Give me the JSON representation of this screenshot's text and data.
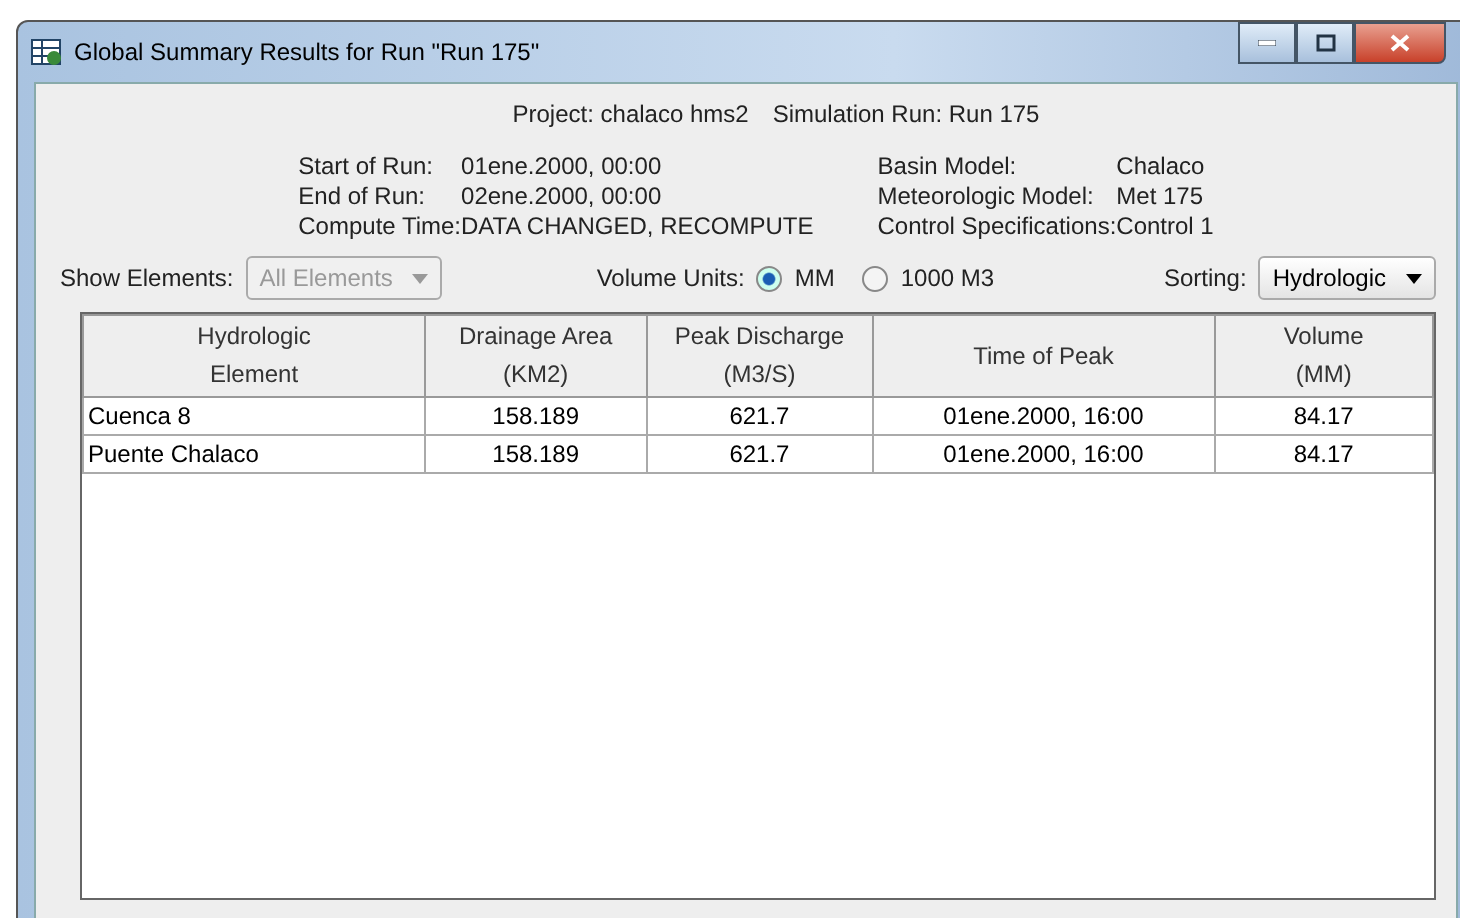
{
  "window": {
    "title": "Global Summary Results for Run \"Run 175\""
  },
  "header": {
    "project": "Project: chalaco hms2",
    "simulation_run": "Simulation Run: Run 175"
  },
  "info_left": [
    {
      "label": "Start of Run:",
      "value": "01ene.2000, 00:00"
    },
    {
      "label": "End of Run:",
      "value": "02ene.2000, 00:00"
    },
    {
      "label": "Compute Time:",
      "value": "DATA CHANGED, RECOMPUTE"
    }
  ],
  "info_right": [
    {
      "label": "Basin Model:",
      "value": "Chalaco"
    },
    {
      "label": "Meteorologic Model:",
      "value": "Met 175"
    },
    {
      "label": "Control Specifications:",
      "value": "Control 1"
    }
  ],
  "show_elements": {
    "label": "Show Elements:",
    "value": "All Elements",
    "disabled": true
  },
  "volume_units": {
    "label": "Volume Units:",
    "options": [
      {
        "label": "MM",
        "selected": true
      },
      {
        "label": "1000 M3",
        "selected": false
      }
    ]
  },
  "sorting": {
    "label": "Sorting:",
    "value": "Hydrologic"
  },
  "table": {
    "columns": [
      "Hydrologic\nElement",
      "Drainage Area\n(KM2)",
      "Peak Discharge\n(M3/S)",
      "Time of Peak",
      "Volume\n(MM)"
    ],
    "rows": [
      [
        "Cuenca 8",
        "158.189",
        "621.7",
        "01ene.2000, 16:00",
        "84.17"
      ],
      [
        "Puente Chalaco",
        "158.189",
        "621.7",
        "01ene.2000, 16:00",
        "84.17"
      ]
    ]
  }
}
